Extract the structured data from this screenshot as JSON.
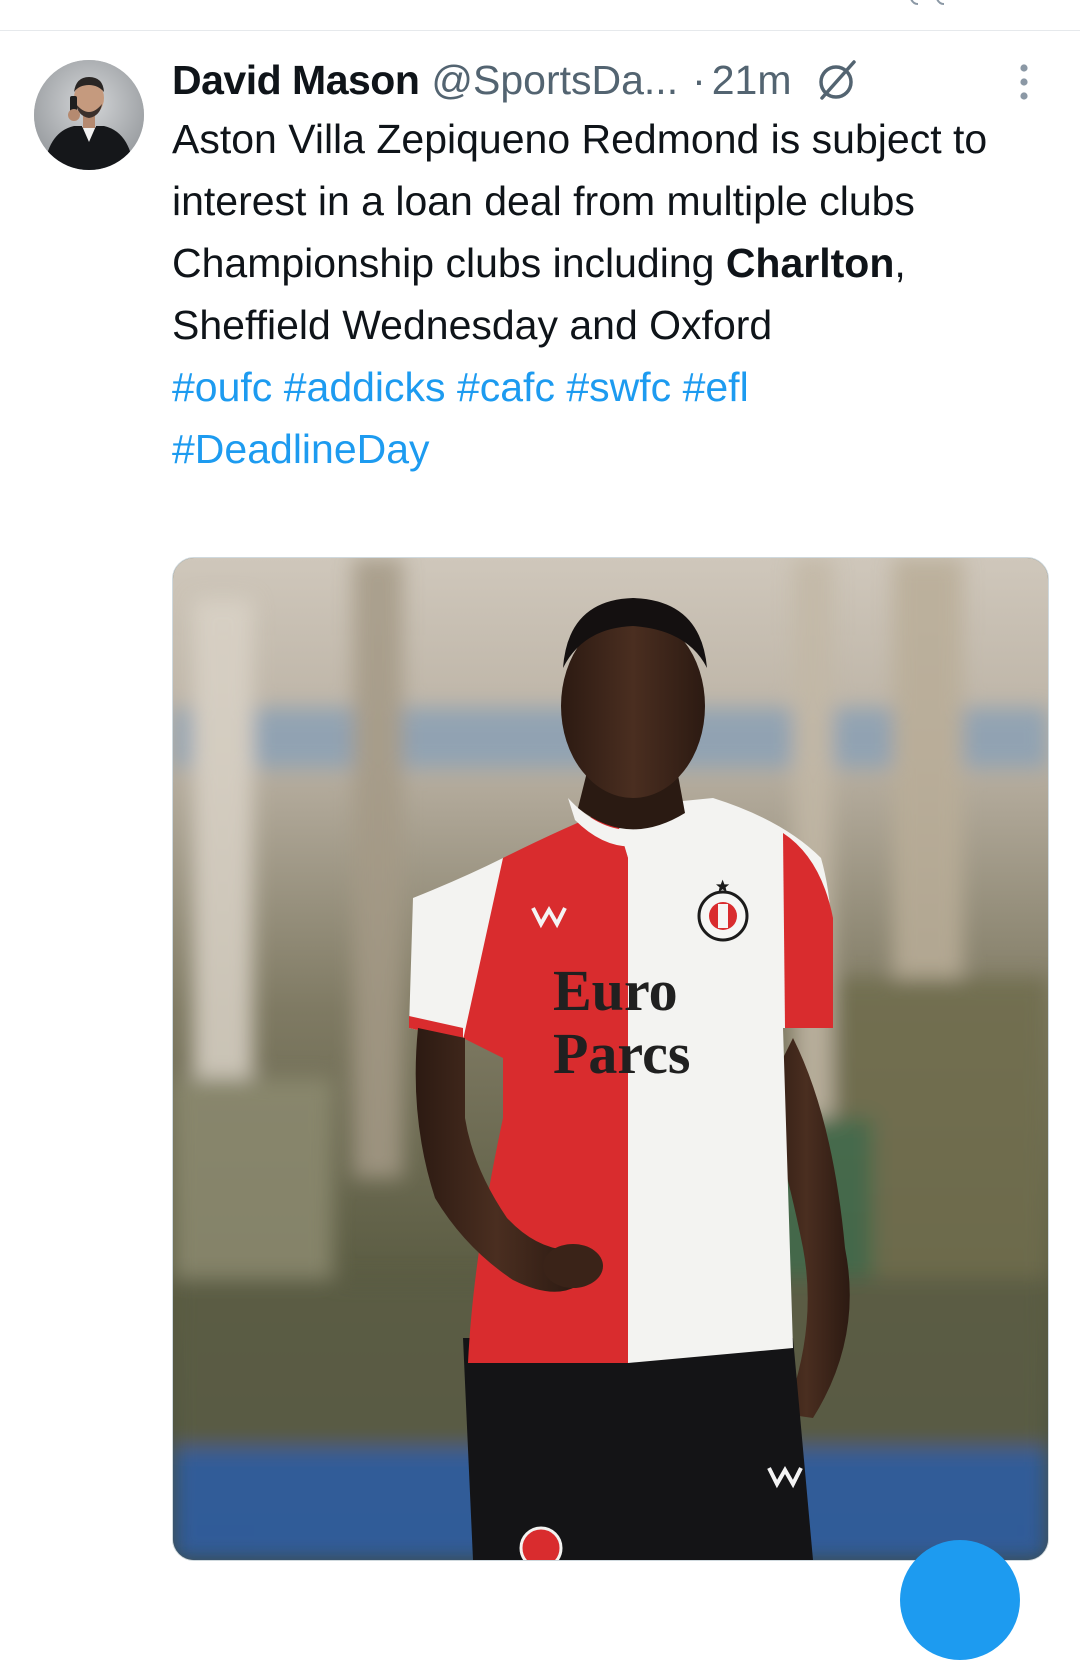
{
  "tweet": {
    "author_name": "David Mason",
    "handle": "@SportsDa...",
    "separator": "·",
    "time": "21m",
    "text_part1": "Aston Villa Zepiqueno Redmond is subject to interest in a loan deal from multiple clubs Championship clubs including ",
    "text_bold": "Charlton",
    "text_part2": ", Sheffield Wednesday and Oxford",
    "hashtags": [
      "#oufc",
      "#addicks",
      "#cafc",
      "#swfc",
      "#efl",
      "#DeadlineDay"
    ]
  },
  "media": {
    "shirt_sponsor_line1": "Euro",
    "shirt_sponsor_line2": "Parcs",
    "icons": [
      "castore-logo",
      "feyenoord-crest"
    ]
  },
  "icons": [
    "grok-icon",
    "more-icon"
  ],
  "colors": {
    "link": "#1d9bf0",
    "text": "#0f1419",
    "secondary": "#536471",
    "divider": "#e6e9ec",
    "shirt_red": "#d92c2e"
  }
}
